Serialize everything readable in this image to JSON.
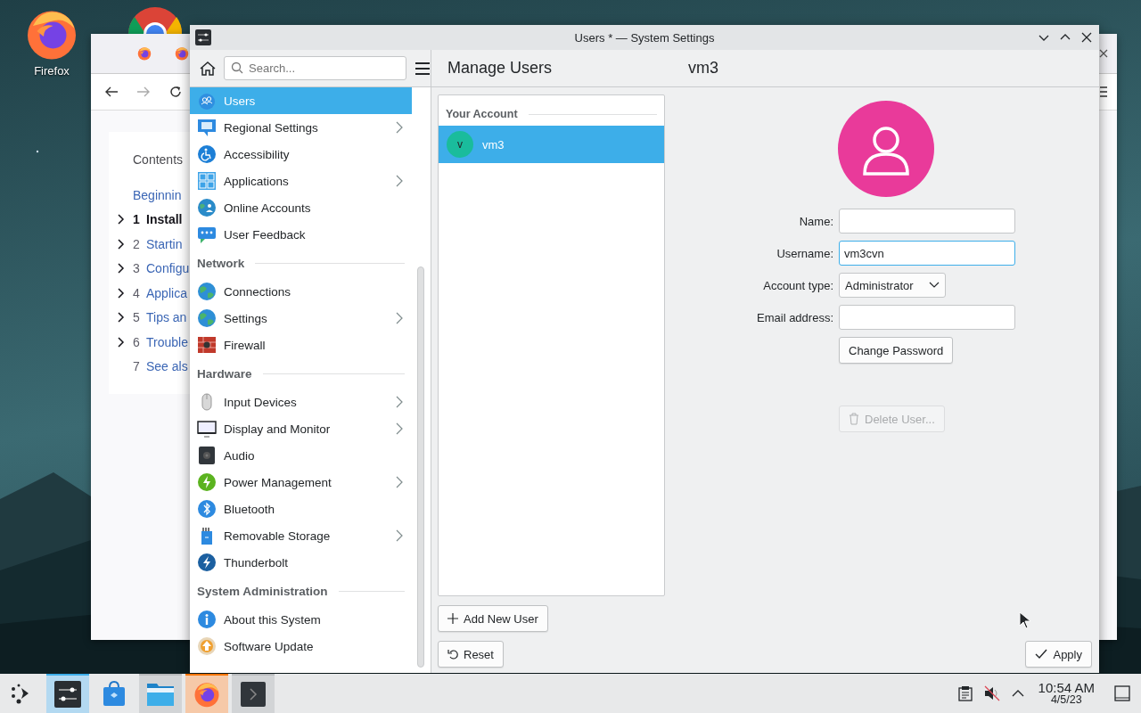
{
  "desktop": {
    "icons": [
      {
        "kind": "firefox",
        "label": "Firefox"
      },
      {
        "kind": "chrome"
      }
    ]
  },
  "browser": {
    "tabs": [
      {
        "kind": "firefox"
      },
      {
        "kind": "firefox"
      }
    ],
    "toc_title": "Contents",
    "toc": [
      {
        "title": "Beginnin",
        "expandable": false,
        "current": false
      },
      {
        "number": "1",
        "title": "Install",
        "expandable": true,
        "current": true
      },
      {
        "number": "2",
        "title": "Startin",
        "expandable": true,
        "current": false
      },
      {
        "number": "3",
        "title": "Configu",
        "expandable": true,
        "current": false
      },
      {
        "number": "4",
        "title": "Applica",
        "expandable": true,
        "current": false
      },
      {
        "number": "5",
        "title": "Tips an",
        "expandable": true,
        "current": false
      },
      {
        "number": "6",
        "title": "Trouble",
        "expandable": true,
        "current": false
      },
      {
        "number": "7",
        "title": "See als",
        "expandable": false,
        "current": false
      }
    ]
  },
  "settings": {
    "window_title": "Users * — System Settings",
    "search": {
      "placeholder": "Search..."
    },
    "page_title": "Manage Users",
    "user_heading": "vm3",
    "sidebar": [
      {
        "items": [
          {
            "label": "Users",
            "kind": "users",
            "submenu": false,
            "selected": true
          },
          {
            "label": "Regional Settings",
            "kind": "regional",
            "submenu": true,
            "selected": false
          },
          {
            "label": "Accessibility",
            "kind": "accessibility",
            "submenu": false,
            "selected": false
          },
          {
            "label": "Applications",
            "kind": "applications",
            "submenu": true,
            "selected": false
          },
          {
            "label": "Online Accounts",
            "kind": "online",
            "submenu": false,
            "selected": false
          },
          {
            "label": "User Feedback",
            "kind": "feedback",
            "submenu": false,
            "selected": false
          }
        ]
      },
      {
        "heading": "Network",
        "items": [
          {
            "label": "Connections",
            "kind": "globe",
            "submenu": false,
            "selected": false
          },
          {
            "label": "Settings",
            "kind": "globe",
            "submenu": true,
            "selected": false
          },
          {
            "label": "Firewall",
            "kind": "firewall",
            "submenu": false,
            "selected": false
          }
        ]
      },
      {
        "heading": "Hardware",
        "items": [
          {
            "label": "Input Devices",
            "kind": "mouse",
            "submenu": true,
            "selected": false
          },
          {
            "label": "Display and Monitor",
            "kind": "display",
            "submenu": true,
            "selected": false
          },
          {
            "label": "Audio",
            "kind": "audio",
            "submenu": false,
            "selected": false
          },
          {
            "label": "Power Management",
            "kind": "power",
            "submenu": true,
            "selected": false
          },
          {
            "label": "Bluetooth",
            "kind": "bluetooth",
            "submenu": false,
            "selected": false
          },
          {
            "label": "Removable Storage",
            "kind": "storage",
            "submenu": true,
            "selected": false
          },
          {
            "label": "Thunderbolt",
            "kind": "thunderbolt",
            "submenu": false,
            "selected": false
          }
        ]
      },
      {
        "heading": "System Administration",
        "items": [
          {
            "label": "About this System",
            "kind": "info",
            "submenu": false,
            "selected": false
          },
          {
            "label": "Software Update",
            "kind": "update",
            "submenu": false,
            "selected": false
          }
        ]
      }
    ],
    "account_list": {
      "heading": "Your Account",
      "users": [
        {
          "initial": "v",
          "name": "vm3",
          "selected": true
        }
      ]
    },
    "form": {
      "fields": [
        {
          "label": "Name:",
          "kind": "text",
          "focused": false
        },
        {
          "label": "Username:",
          "kind": "text",
          "value": "vm3cvn",
          "focused": true
        },
        {
          "label": "Account type:",
          "kind": "combo",
          "value": "Administrator"
        },
        {
          "label": "Email address:",
          "kind": "text",
          "focused": false
        }
      ],
      "change_password": "Change Password",
      "delete_user": {
        "label": "Delete User...",
        "disabled": true
      }
    },
    "add_user": "Add New User",
    "reset": "Reset",
    "apply": "Apply"
  },
  "taskbar": {
    "apps": [
      {
        "kind": "launcher",
        "running": false,
        "selected": false,
        "attention": false
      },
      {
        "kind": "settings",
        "running": true,
        "selected": true,
        "attention": false
      },
      {
        "kind": "discover",
        "running": false,
        "selected": false,
        "attention": false
      },
      {
        "kind": "files",
        "running": true,
        "selected": false,
        "attention": false
      },
      {
        "kind": "firefox",
        "running": true,
        "selected": false,
        "attention": true
      },
      {
        "kind": "terminal",
        "running": true,
        "selected": false,
        "attention": false
      }
    ],
    "clock": {
      "time": "10:54 AM",
      "date": "4/5/23"
    }
  }
}
